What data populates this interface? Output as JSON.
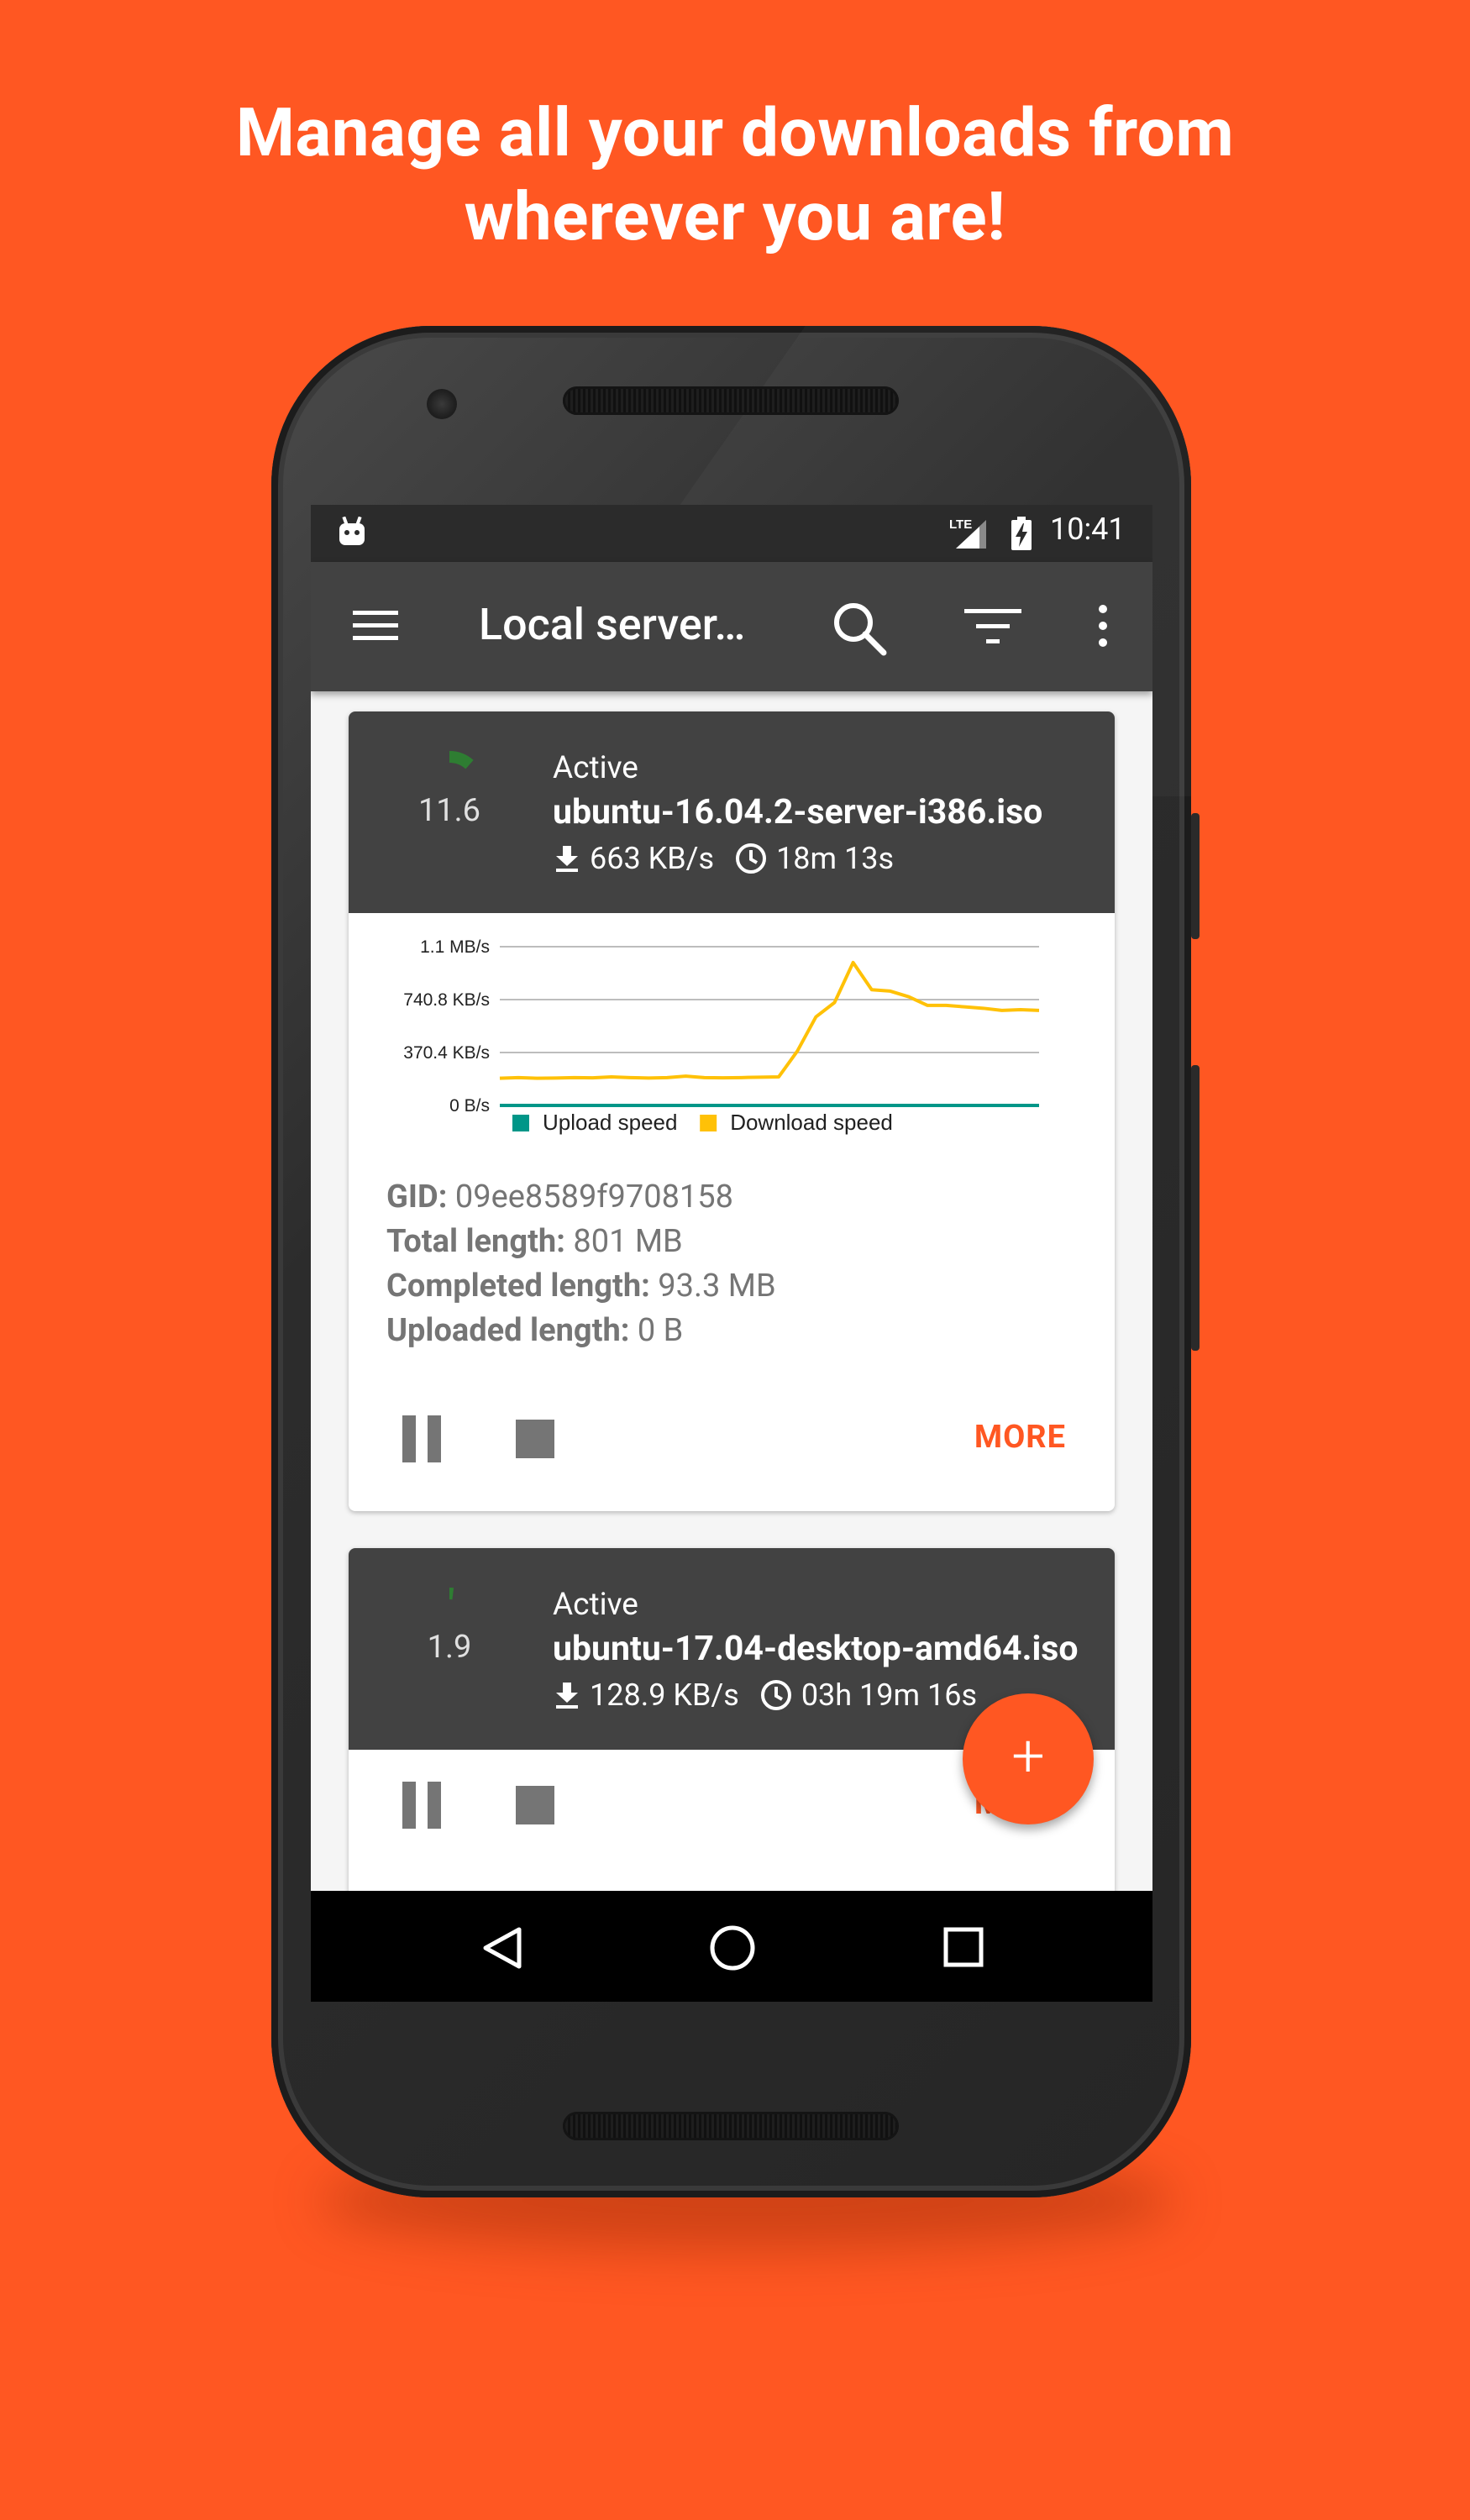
{
  "headline": {
    "line1": "Manage all your downloads from",
    "line2": "wherever you are!"
  },
  "statusbar": {
    "time": "10:41",
    "network": "LTE"
  },
  "appbar": {
    "title": "Local server…"
  },
  "downloads": [
    {
      "status": "Active",
      "filename": "ubuntu-16.04.2-server-i386.iso",
      "progress": "11.6",
      "progress_fraction": 0.116,
      "speed": "663 KB/s",
      "eta": "18m 13s",
      "gid_label": "GID:",
      "gid": "09ee8589f9708158",
      "total_label": "Total length:",
      "total": "801 MB",
      "completed_label": "Completed length:",
      "completed": "93.3 MB",
      "uploaded_label": "Uploaded length:",
      "uploaded": "0 B",
      "more": "MORE"
    },
    {
      "status": "Active",
      "filename": "ubuntu-17.04-desktop-amd64.iso",
      "progress": "1.9",
      "progress_fraction": 0.019,
      "speed": "128.9 KB/s",
      "eta": "03h 19m 16s",
      "more": "MORE"
    }
  ],
  "chart_data": {
    "type": "line",
    "y_ticks": [
      "1.1 MB/s",
      "740.8 KB/s",
      "370.4 KB/s",
      "0 B/s"
    ],
    "ylim_kbps": [
      0,
      1111
    ],
    "series": [
      {
        "name": "Upload speed",
        "color": "#009688",
        "values": [
          0,
          0,
          0,
          0,
          0,
          0,
          0,
          0,
          0,
          0,
          0,
          0,
          0,
          0,
          0,
          0,
          0,
          0,
          0,
          0,
          0,
          0,
          0,
          0,
          0,
          0,
          0,
          0,
          0,
          0
        ]
      },
      {
        "name": "Download speed",
        "color": "#FFC107",
        "values": [
          190,
          195,
          190,
          192,
          195,
          193,
          200,
          195,
          192,
          195,
          205,
          195,
          193,
          195,
          198,
          200,
          380,
          620,
          720,
          1000,
          810,
          800,
          760,
          700,
          700,
          690,
          680,
          665,
          670,
          665
        ]
      }
    ],
    "legend_position": "bottom"
  },
  "fab": {
    "label": "+"
  }
}
